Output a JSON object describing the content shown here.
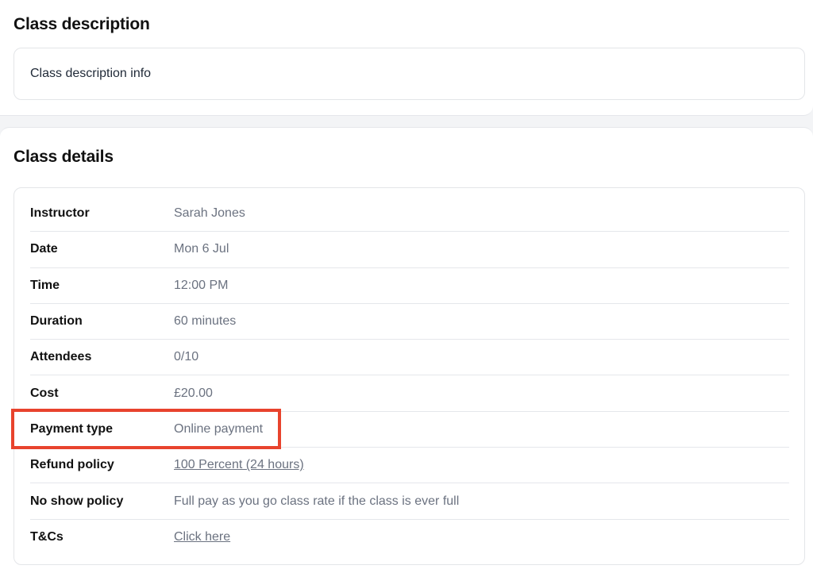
{
  "description_section": {
    "title": "Class description",
    "text": "Class description info"
  },
  "details_section": {
    "title": "Class details",
    "rows": [
      {
        "label": "Instructor",
        "value": "Sarah Jones"
      },
      {
        "label": "Date",
        "value": "Mon 6 Jul"
      },
      {
        "label": "Time",
        "value": "12:00 PM"
      },
      {
        "label": "Duration",
        "value": "60 minutes"
      },
      {
        "label": "Attendees",
        "value": "0/10"
      },
      {
        "label": "Cost",
        "value": "£20.00"
      },
      {
        "label": "Payment type",
        "value": "Online payment"
      },
      {
        "label": "Refund policy",
        "value": "100 Percent (24 hours)"
      },
      {
        "label": "No show policy",
        "value": "Full pay as you go class rate if the class is ever full"
      },
      {
        "label": "T&Cs",
        "value": "Click here"
      }
    ]
  },
  "highlight": {
    "color": "#e8432d",
    "target": "Payment type"
  }
}
